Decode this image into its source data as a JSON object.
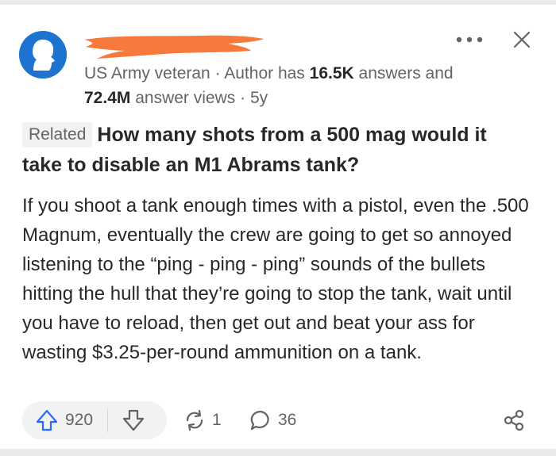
{
  "author": {
    "credential": "US Army veteran",
    "meta_prefix": " · Author has ",
    "answers_count": "16.5K",
    "answers_suffix": " answers and",
    "views_count": "72.4M",
    "views_suffix": " answer views",
    "time_sep": " · ",
    "time_ago": "5y",
    "redaction_color": "#f57a3c"
  },
  "question": {
    "badge": "Related",
    "title": "How many shots from a 500 mag would it take to disable an M1 Abrams tank?"
  },
  "answer": {
    "text": "If you shoot a tank enough times with a pistol, even the .500 Magnum, eventually the crew are going to get so annoyed listening to the “ping - ping - ping” sounds of the bullets hitting the hull that they’re going to stop the tank, wait until you have to reload, then get out and beat your ass for wasting $3.25-per-round ammunition on a tank."
  },
  "actions": {
    "upvotes": "920",
    "shares": "1",
    "comments": "36"
  },
  "icons": {
    "more": "more-dots-icon",
    "close": "close-icon",
    "upvote": "upvote-arrow-icon",
    "downvote": "downvote-arrow-icon",
    "reshare": "reshare-icon",
    "comment": "comment-bubble-icon",
    "share": "share-icon"
  },
  "colors": {
    "accent": "#2e69ff",
    "text": "#282829",
    "muted": "#636466",
    "avatar_bg": "#1e73d1"
  }
}
